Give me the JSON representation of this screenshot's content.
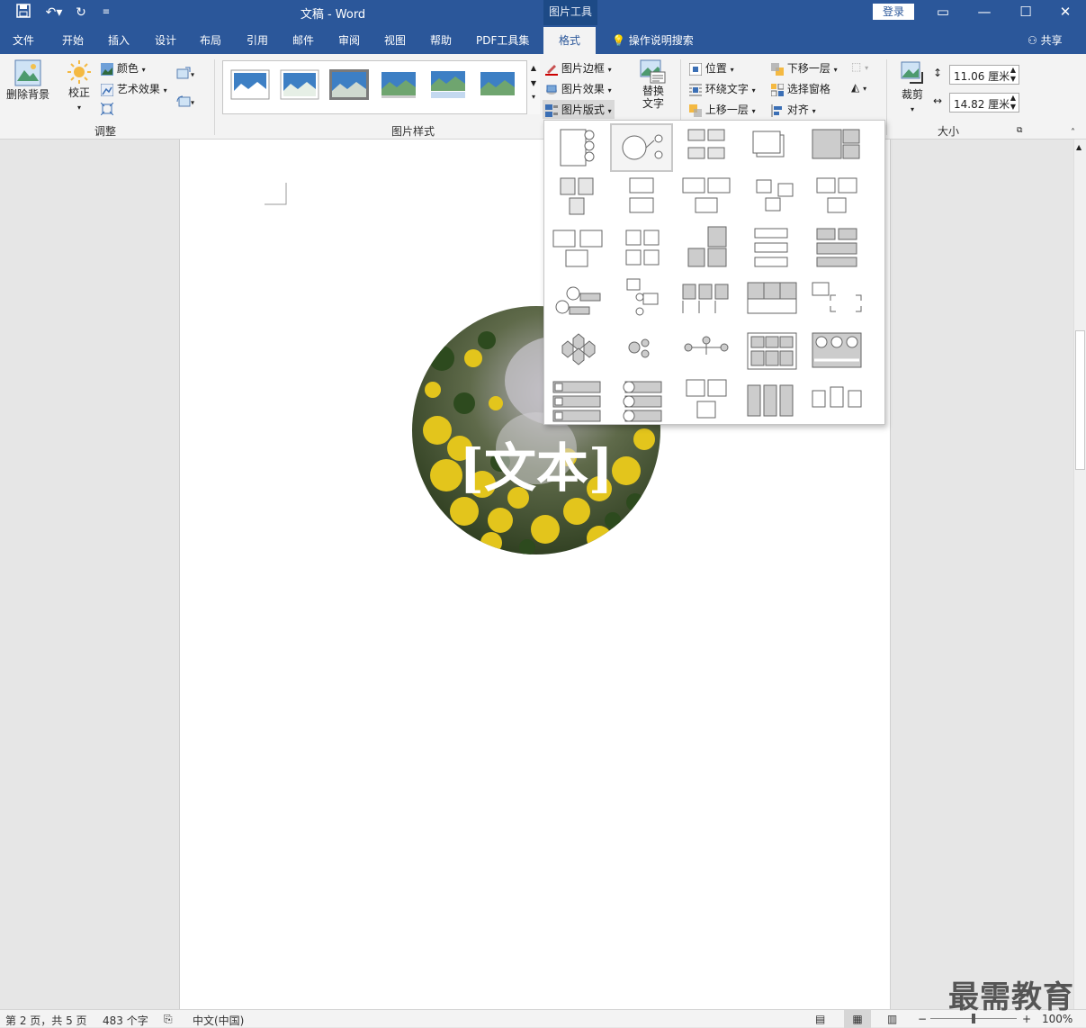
{
  "titlebar": {
    "doc_title": "文稿  -  Word",
    "context_group": "图片工具",
    "login": "登录"
  },
  "tabs": [
    "文件",
    "开始",
    "插入",
    "设计",
    "布局",
    "引用",
    "邮件",
    "审阅",
    "视图",
    "帮助",
    "PDF工具集"
  ],
  "active_tab": "格式",
  "tell_me": "操作说明搜索",
  "share": "共享",
  "ribbon": {
    "remove_bg": "删除背景",
    "corrections": "校正",
    "color": "颜色",
    "artistic": "艺术效果",
    "group_adjust": "调整",
    "group_styles": "图片样式",
    "border": "图片边框",
    "effects": "图片效果",
    "layout": "图片版式",
    "alt_text_1": "替换",
    "alt_text_2": "文字",
    "position": "位置",
    "wrap": "环绕文字",
    "bring_forward": "上移一层",
    "send_backward": "下移一层",
    "selection_pane": "选择窗格",
    "align": "对齐",
    "crop": "裁剪",
    "height": "11.06 厘米",
    "width": "14.82 厘米",
    "group_size": "大小"
  },
  "picture_text": "[文本]",
  "status": {
    "page": "第 2 页，共 5 页",
    "words": "483 个字",
    "lang": "中文(中国)",
    "zoom": "100%"
  },
  "watermark": "最需教育"
}
